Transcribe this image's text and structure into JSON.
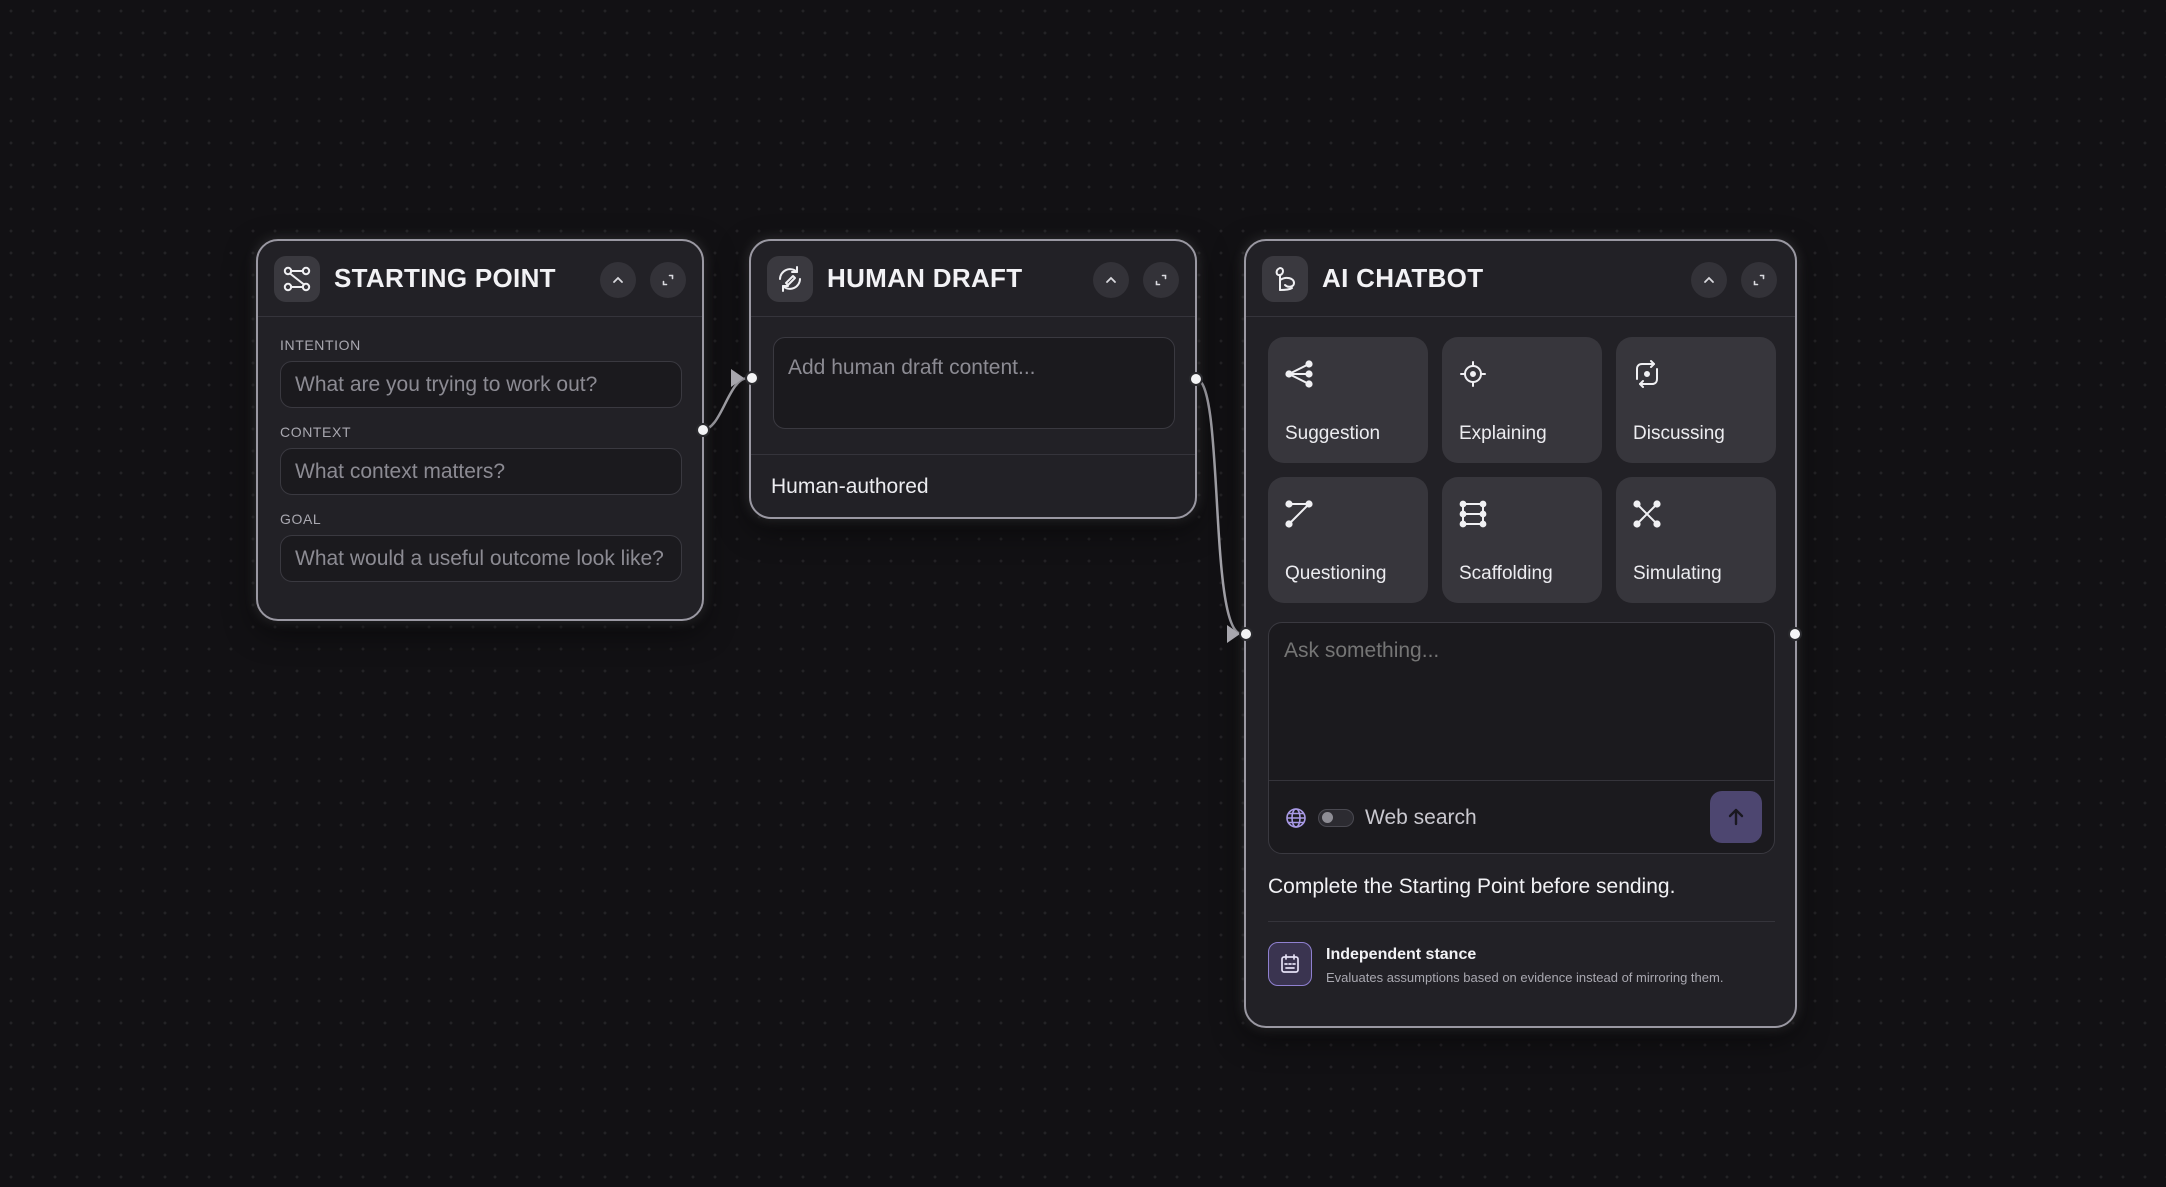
{
  "nodes": {
    "starting_point": {
      "title": "STARTING POINT",
      "icon": "flow-nodes-icon",
      "fields": [
        {
          "label": "INTENTION",
          "placeholder": "What are you trying to work out?",
          "value": ""
        },
        {
          "label": "CONTEXT",
          "placeholder": "What context matters?",
          "value": ""
        },
        {
          "label": "GOAL",
          "placeholder": "What would a useful outcome look like?",
          "value": ""
        }
      ]
    },
    "human_draft": {
      "title": "HUMAN DRAFT",
      "icon": "refresh-edit-icon",
      "content_placeholder": "Add human draft content...",
      "footer": "Human-authored"
    },
    "ai_chatbot": {
      "title": "AI CHATBOT",
      "icon": "bot-icon",
      "modes": [
        {
          "label": "Suggestion",
          "icon": "share-branch-icon"
        },
        {
          "label": "Explaining",
          "icon": "target-icon"
        },
        {
          "label": "Discussing",
          "icon": "cycle-icon"
        },
        {
          "label": "Questioning",
          "icon": "diagonal-path-icon"
        },
        {
          "label": "Scaffolding",
          "icon": "ladder-icon"
        },
        {
          "label": "Simulating",
          "icon": "cross-nodes-icon"
        }
      ],
      "ask_placeholder": "Ask something...",
      "web_search_label": "Web search",
      "web_search_enabled": false,
      "notice": "Complete the Starting Point before sending.",
      "stance": {
        "title": "Independent stance",
        "description": "Evaluates assumptions based on evidence instead of mirroring them."
      }
    }
  },
  "colors": {
    "canvas": "#121114",
    "node": "#222126",
    "tile": "#37363c",
    "accent": "#a99ae6",
    "send_button": "#4d4670"
  }
}
